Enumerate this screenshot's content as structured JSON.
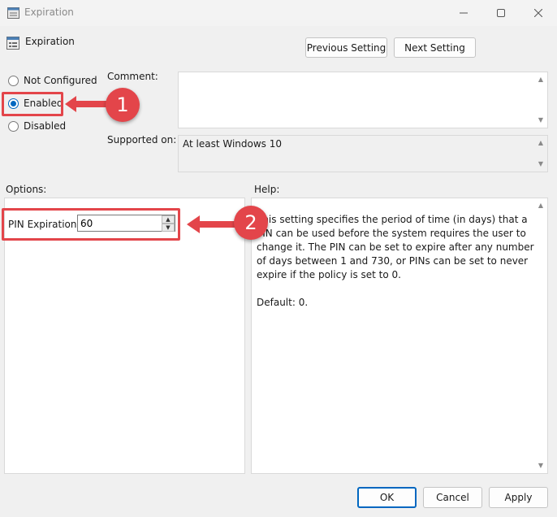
{
  "window": {
    "title": "Expiration"
  },
  "header": {
    "policy_title": "Expiration",
    "prev_button": "Previous Setting",
    "next_button": "Next Setting"
  },
  "state": {
    "not_configured": "Not Configured",
    "enabled": "Enabled",
    "disabled": "Disabled",
    "selected": "Enabled"
  },
  "labels": {
    "comment": "Comment:",
    "supported_on": "Supported on:",
    "options": "Options:",
    "help": "Help:"
  },
  "supported_on_value": "At least Windows 10",
  "options": {
    "pin_label": "PIN Expiration",
    "pin_value": "60"
  },
  "help": {
    "paragraph1": "This setting specifies the period of time (in days) that a PIN can be used before the system requires the user to change it. The PIN can be set to expire after any number of days between 1 and 730, or PINs can be set to never expire if the policy is set to 0.",
    "paragraph2": "Default: 0."
  },
  "footer": {
    "ok": "OK",
    "cancel": "Cancel",
    "apply": "Apply"
  },
  "annotations": {
    "step1": "1",
    "step2": "2"
  },
  "colors": {
    "accent": "#0067c0",
    "annotation": "#e3454a"
  }
}
